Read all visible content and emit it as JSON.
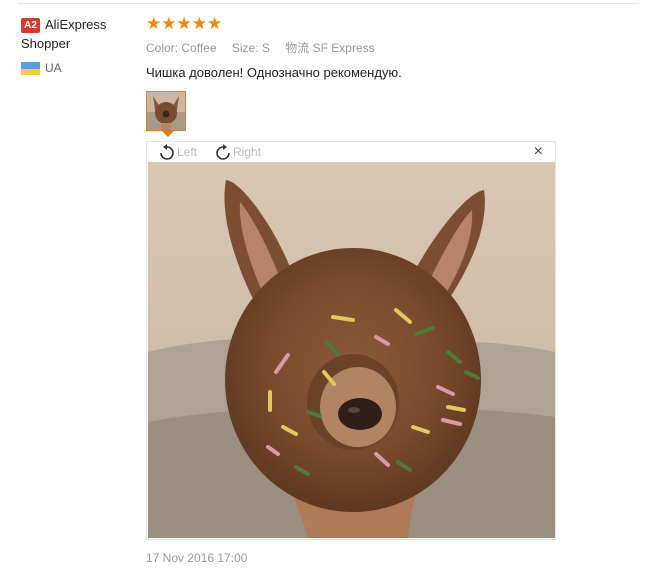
{
  "user": {
    "badge": "A2",
    "name": "AliExpress Shopper",
    "country": "UA",
    "flag_colors": [
      "#5b9be0",
      "#f0d33a"
    ]
  },
  "review": {
    "stars": "★★★★★",
    "rating": 5,
    "color_label": "Color:",
    "color_value": "Coffee",
    "size_label": "Size:",
    "size_value": "S",
    "shipping_label": "物流",
    "shipping_value": "SF Express",
    "text": "Чишка доволен! Однозначно рекомендую.",
    "date": "17 Nov 2016 17:00"
  },
  "viewer": {
    "rotate_left_label": "Left",
    "rotate_right_label": "Right",
    "close_label": "×",
    "rotate_left_icon": "rotate-left-icon",
    "rotate_right_icon": "rotate-right-icon"
  },
  "colors": {
    "star": "#f08a00",
    "accent_border": "#e07a2a",
    "badge": "#d9382b"
  }
}
